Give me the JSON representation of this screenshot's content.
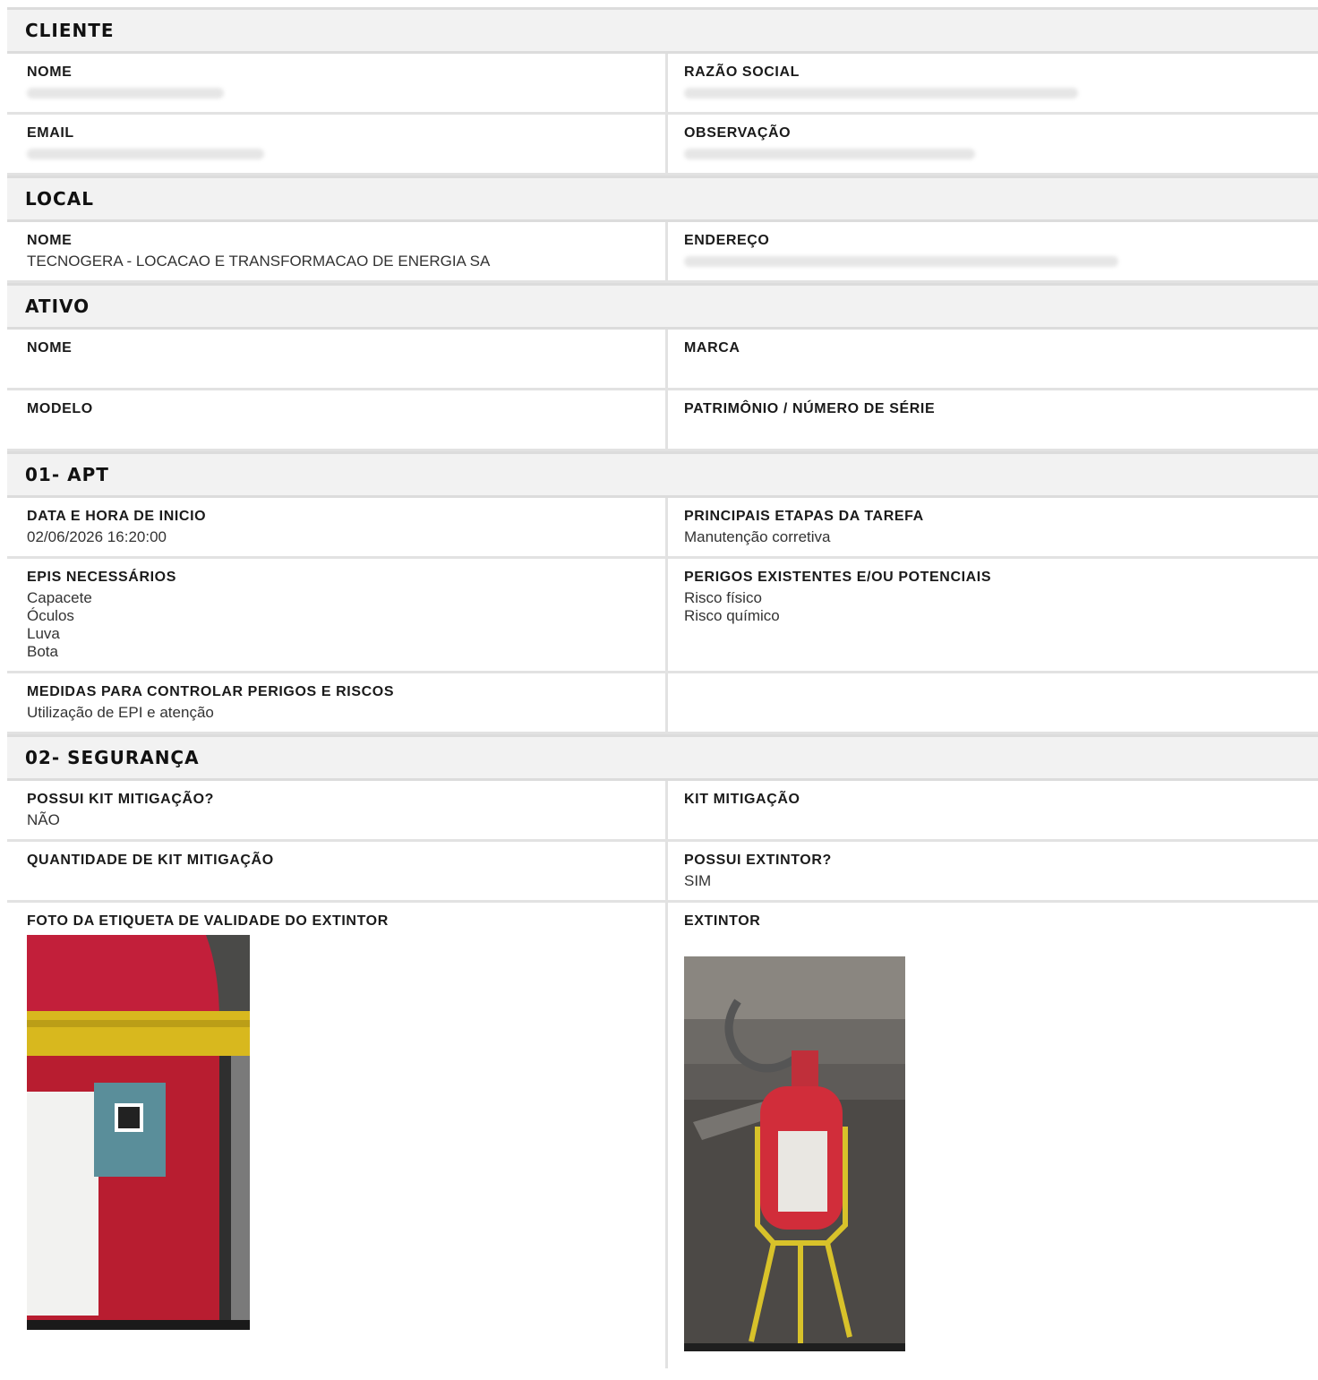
{
  "cliente": {
    "title": "CLIENTE",
    "nome_label": "NOME",
    "razao_label": "RAZÃO SOCIAL",
    "email_label": "EMAIL",
    "obs_label": "OBSERVAÇÃO"
  },
  "local": {
    "title": "LOCAL",
    "nome_label": "NOME",
    "nome_value": "TECNOGERA - LOCACAO E TRANSFORMACAO DE ENERGIA SA",
    "endereco_label": "ENDEREÇO"
  },
  "ativo": {
    "title": "ATIVO",
    "nome_label": "NOME",
    "marca_label": "MARCA",
    "modelo_label": "MODELO",
    "patrimonio_label": "PATRIMÔNIO / NÚMERO DE SÉRIE"
  },
  "apt": {
    "title": "01- APT",
    "data_label": "DATA E HORA DE INICIO",
    "data_value": "02/06/2026 16:20:00",
    "etapas_label": "PRINCIPAIS ETAPAS DA TAREFA",
    "etapas_value": "Manutenção corretiva",
    "epis_label": "EPIS NECESSÁRIOS",
    "epis": [
      "Capacete",
      "Óculos",
      "Luva",
      "Bota"
    ],
    "perigos_label": "PERIGOS EXISTENTES E/OU POTENCIAIS",
    "perigos": [
      "Risco físico",
      "Risco químico"
    ],
    "medidas_label": "MEDIDAS PARA CONTROLAR PERIGOS E RISCOS",
    "medidas_value": "Utilização de EPI e atenção"
  },
  "seguranca": {
    "title": "02- SEGURANÇA",
    "possui_kit_label": "POSSUI KIT MITIGAÇÃO?",
    "possui_kit_value": "NÃO",
    "kit_label": "KIT MITIGAÇÃO",
    "qtd_kit_label": "QUANTIDADE DE KIT MITIGAÇÃO",
    "possui_extintor_label": "POSSUI EXTINTOR?",
    "possui_extintor_value": "SIM",
    "foto_etiqueta_label": "FOTO DA ETIQUETA DE VALIDADE DO EXTINTOR",
    "extintor_label": "EXTINTOR"
  }
}
